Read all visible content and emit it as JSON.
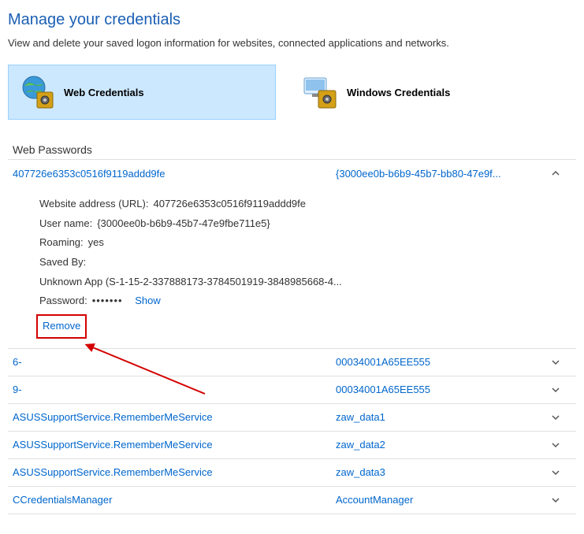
{
  "header": {
    "title": "Manage your credentials",
    "subtitle": "View and delete your saved logon information for websites, connected applications and networks."
  },
  "tabs": {
    "web": "Web Credentials",
    "windows": "Windows Credentials"
  },
  "section": {
    "title": "Web Passwords"
  },
  "expanded": {
    "site": "407726e6353c0516f9119addd9fe",
    "ident": "{3000ee0b-b6b9-45b7-bb80-47e9f...",
    "url_label": "Website address (URL):",
    "url_value": "407726e6353c0516f9119addd9fe",
    "user_label": "User name:",
    "user_value": "{3000ee0b-b6b9-45b7-47e9fbe711e5}",
    "roaming_label": "Roaming:",
    "roaming_value": "yes",
    "savedby_label": "Saved By:",
    "savedby_value": "Unknown App (S-1-15-2-337888173-3784501919-3848985668-4...",
    "password_label": "Password:",
    "password_mask": "•••••••",
    "show": "Show",
    "remove": "Remove"
  },
  "rows": [
    {
      "left": "6-",
      "right": "00034001A65EE555"
    },
    {
      "left": "9-",
      "right": "00034001A65EE555"
    },
    {
      "left": "ASUSSupportService.RememberMeService",
      "right": "zaw_data1"
    },
    {
      "left": "ASUSSupportService.RememberMeService",
      "right": "zaw_data2"
    },
    {
      "left": "ASUSSupportService.RememberMeService",
      "right": "zaw_data3"
    },
    {
      "left": "CCredentialsManager",
      "right": "AccountManager"
    }
  ]
}
